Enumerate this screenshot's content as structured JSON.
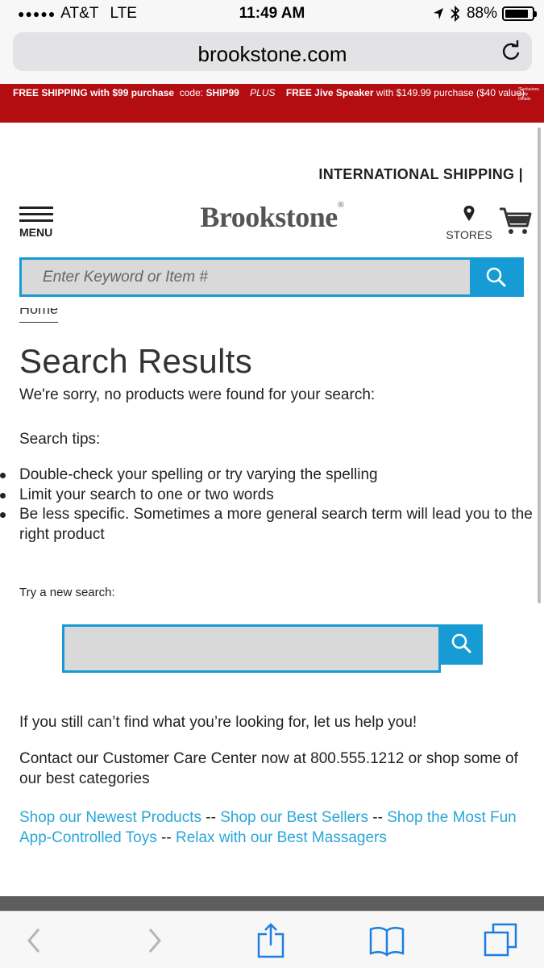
{
  "status_bar": {
    "carrier": "AT&T",
    "network": "LTE",
    "time": "11:49 AM",
    "battery": "88%",
    "battery_level": 0.88
  },
  "browser": {
    "url": "brookstone.com"
  },
  "promo": {
    "part1": "FREE SHIPPING with $99 purchase",
    "part2": "code:",
    "part3": "SHIP99",
    "part4": "PLUS",
    "part5": "FREE Jive Speaker",
    "part6": "with $149.99 purchase ($40 value)",
    "note": "*Exclusions apply Details"
  },
  "header": {
    "international": "INTERNATIONAL SHIPPING |",
    "menu_label": "MENU",
    "logo": "Brookstone",
    "logo_mark": "®",
    "stores_label": "STORES"
  },
  "search": {
    "placeholder": "Enter Keyword or Item #"
  },
  "content": {
    "breadcrumb": "Home",
    "title": "Search Results",
    "sorry": "We're sorry, no products were found for your search:",
    "tips_label": "Search tips:",
    "tips": [
      "Double-check your spelling or try varying the spelling",
      "Limit your search to one or two words",
      "Be less specific. Sometimes a more general search term will lead you to the right product"
    ],
    "try_label": "Try a new search:",
    "still": "If you still can’t find what you’re looking for, let us help you!",
    "contact": "Contact our Customer Care Center now at 800.555.1212 or shop some of our best categories",
    "links": [
      "Shop our Newest Products",
      "Shop our Best Sellers",
      "Shop the Most Fun App-Controlled Toys",
      "Relax with our Best Massagers"
    ],
    "separator": "--"
  },
  "colors": {
    "accent": "#169bd5",
    "promo_bg": "#b30d12",
    "link": "#2aa6d6"
  }
}
